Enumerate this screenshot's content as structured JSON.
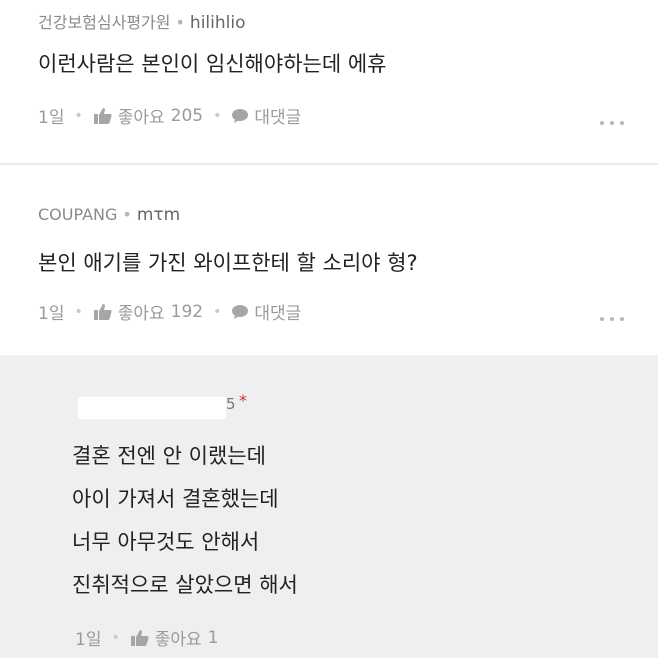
{
  "comments": [
    {
      "source": "건강보험심사평가원",
      "author": "hilihlio",
      "text": "이런사람은 본인이 임신해야하는데 에휴",
      "time": "1일",
      "like_label": "좋아요",
      "like_count": "205",
      "reply_label": "대댓글"
    },
    {
      "source": "COUPANG",
      "author": "mτm",
      "text": "본인 애기를 가진 와이프한테 할 소리야 형?",
      "time": "1일",
      "like_label": "좋아요",
      "like_count": "192",
      "reply_label": "대댓글"
    }
  ],
  "reply": {
    "author_tail": "5",
    "badge": "*",
    "lines": [
      "결혼 전엔 안 이랬는데",
      "아이 가져서 결혼했는데",
      "너무 아무것도 안해서",
      "진취적으로 살았으면 해서"
    ],
    "time": "1일",
    "like_label": "좋아요",
    "like_count": "1"
  },
  "icons": {
    "like": "thumbs-up-icon",
    "reply": "speech-bubble-icon",
    "more": "more-dots-icon"
  },
  "colors": {
    "reply_background": "#efeff2",
    "badge_red": "#d9302c"
  }
}
